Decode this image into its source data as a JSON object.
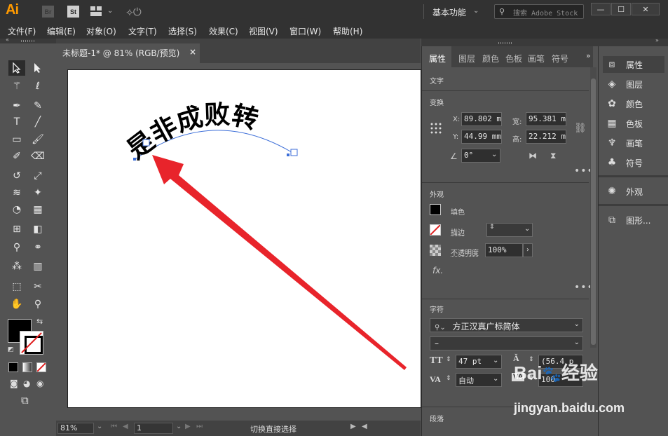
{
  "app": {
    "logo": "Ai",
    "bridge": "Br",
    "stock": "St",
    "workspace": "基本功能",
    "search_placeholder": "搜索 Adobe Stock"
  },
  "menu": [
    "文件(F)",
    "编辑(E)",
    "对象(O)",
    "文字(T)",
    "选择(S)",
    "效果(C)",
    "视图(V)",
    "窗口(W)",
    "帮助(H)"
  ],
  "document": {
    "tab_title": "未标题-1* @ 81% (RGB/预览)",
    "close": "×",
    "artwork_text": "是非成败转"
  },
  "status": {
    "zoom": "81%",
    "page": "1",
    "status_text": "切换直接选择"
  },
  "panel": {
    "tabs": [
      "属性",
      "图层",
      "颜色",
      "色板",
      "画笔",
      "符号"
    ],
    "section_text": "文字",
    "transform": {
      "title": "变换",
      "x_label": "X:",
      "x": "89.802 m",
      "y_label": "Y:",
      "y": "44.99 mm",
      "w_label": "宽:",
      "w": "95.381 m",
      "h_label": "高:",
      "h": "22.212 m",
      "angle": "0°"
    },
    "appearance": {
      "title": "外观",
      "fill": "填色",
      "stroke": "描边",
      "opacity_label": "不透明度",
      "opacity": "100%",
      "fx": "fx."
    },
    "character": {
      "title": "字符",
      "font": "方正汉真广标简体",
      "style": "–",
      "size": "47 pt",
      "leading": "(56.4 p",
      "kerning": "自动",
      "tracking": "100"
    },
    "paragraph": {
      "title": "段落"
    }
  },
  "dock": [
    {
      "label": "属性",
      "icon": "properties-icon"
    },
    {
      "label": "图层",
      "icon": "layers-icon"
    },
    {
      "label": "颜色",
      "icon": "color-icon"
    },
    {
      "label": "色板",
      "icon": "swatches-icon"
    },
    {
      "label": "画笔",
      "icon": "brushes-icon"
    },
    {
      "label": "符号",
      "icon": "symbols-icon"
    },
    {
      "label": "外观",
      "icon": "appearance-icon"
    },
    {
      "label": "图形...",
      "icon": "graphic-styles-icon"
    }
  ],
  "watermark": {
    "brand": "Bai",
    "brand2": "经验",
    "site": "jingyan.baidu.com"
  },
  "colors": {
    "arrow": "#e8242b",
    "accent": "#ff9a00",
    "path": "#3c6ed8"
  }
}
